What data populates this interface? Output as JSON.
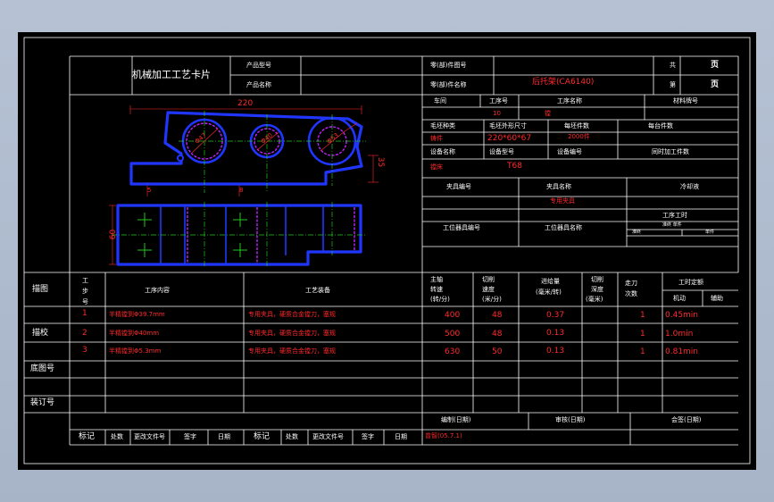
{
  "card": {
    "title": "机械加工工艺卡片",
    "product_model_label": "产品型号",
    "product_name_label": "产品名称",
    "part_no_label": "零(部)件图号",
    "part_name_label": "零(部)件名称",
    "part_name_value": "后托架(CA6140)",
    "total_pages_label": "共",
    "page_label": "页",
    "sheet_label": "第",
    "sheet_page_label": "页"
  },
  "header_grid": {
    "workshop_label": "车间",
    "op_no_label": "工序号",
    "op_name_label": "工序名称",
    "material_label": "材料牌号",
    "op_no_value": "10",
    "op_name_value": "镗",
    "blank_type_label": "毛坯种类",
    "blank_size_label": "毛坯外形尺寸",
    "blank_count_label": "每坯件数",
    "per_unit_label": "每台件数",
    "blank_type_value": "铸件",
    "blank_size_value": "220*60*67",
    "blank_count_value": "2000件",
    "equip_name_label": "设备名称",
    "equip_model_label": "设备型号",
    "equip_no_label": "设备编号",
    "simultaneous_label": "同时加工件数",
    "equip_name_value": "镗床",
    "equip_model_value": "T68",
    "fixture_no_label": "夹具编号",
    "fixture_name_label": "夹具名称",
    "coolant_label": "冷却液",
    "fixture_name_value": "专用夹具",
    "station_no_label": "工位器具编号",
    "station_name_label": "工位器具名称",
    "time_quota_label": "工序工时",
    "time_quota_sub": "准终 单件",
    "time_quota_a": "准终",
    "time_quota_b": "单件"
  },
  "drawing": {
    "dim_length": "220",
    "dim_height": "35",
    "dim_width": "60",
    "dim_left": "5",
    "dim_mid": "8",
    "bore1": "Φ47",
    "bore2": "Φ40",
    "bore3": "Φ53"
  },
  "table": {
    "left_labels": [
      "描图",
      "描校",
      "底图号",
      "装订号"
    ],
    "col_step": "工步号",
    "col_content": "工序内容",
    "col_equip": "工艺装备",
    "col_spindle": [
      "主轴",
      "转速",
      "(转/分)"
    ],
    "col_speed": [
      "切削",
      "速度",
      "(米/分)"
    ],
    "col_feed": [
      "进给量",
      "(毫米/转)"
    ],
    "col_depth": [
      "切削",
      "深度",
      "(毫米)"
    ],
    "col_passes": [
      "走刀",
      "次数"
    ],
    "col_time": "工时定额",
    "col_machine": "机动",
    "col_aux": "辅助",
    "rows": [
      {
        "no": "1",
        "content": "半精镗到Φ39.7mm",
        "equip": "专用夹具，硬质合金镗刀，塞规",
        "rpm": "400",
        "speed": "48",
        "feed": "0.37",
        "passes": "1",
        "time": "0.45min"
      },
      {
        "no": "2",
        "content": "半精镗到Φ40mm",
        "equip": "专用夹具，硬质合金镗刀，塞规",
        "rpm": "500",
        "speed": "48",
        "feed": "0.13",
        "passes": "1",
        "time": "1.0min"
      },
      {
        "no": "3",
        "content": "半精镗到Φ5.3mm",
        "equip": "专用夹具，硬质合金镗刀，塞规",
        "rpm": "630",
        "speed": "50",
        "feed": "0.13",
        "passes": "1",
        "time": "0.81min"
      }
    ]
  },
  "footer": {
    "compile_label": "编制(日期)",
    "review_label": "审核(日期)",
    "sign_label": "会签(日期)",
    "mark_label": "标记",
    "count_label": "处数",
    "doc_no_label": "更改文件号",
    "signature_label": "签字",
    "date_label": "日期",
    "compiler_value": "曾智(05.7.1)"
  },
  "colors": {
    "line": "#ffffff",
    "text": "#ffffff",
    "red": "#ff2a2a",
    "part": "#1f3cff",
    "bore": "#c020ff",
    "axis": "#1fc81f"
  }
}
